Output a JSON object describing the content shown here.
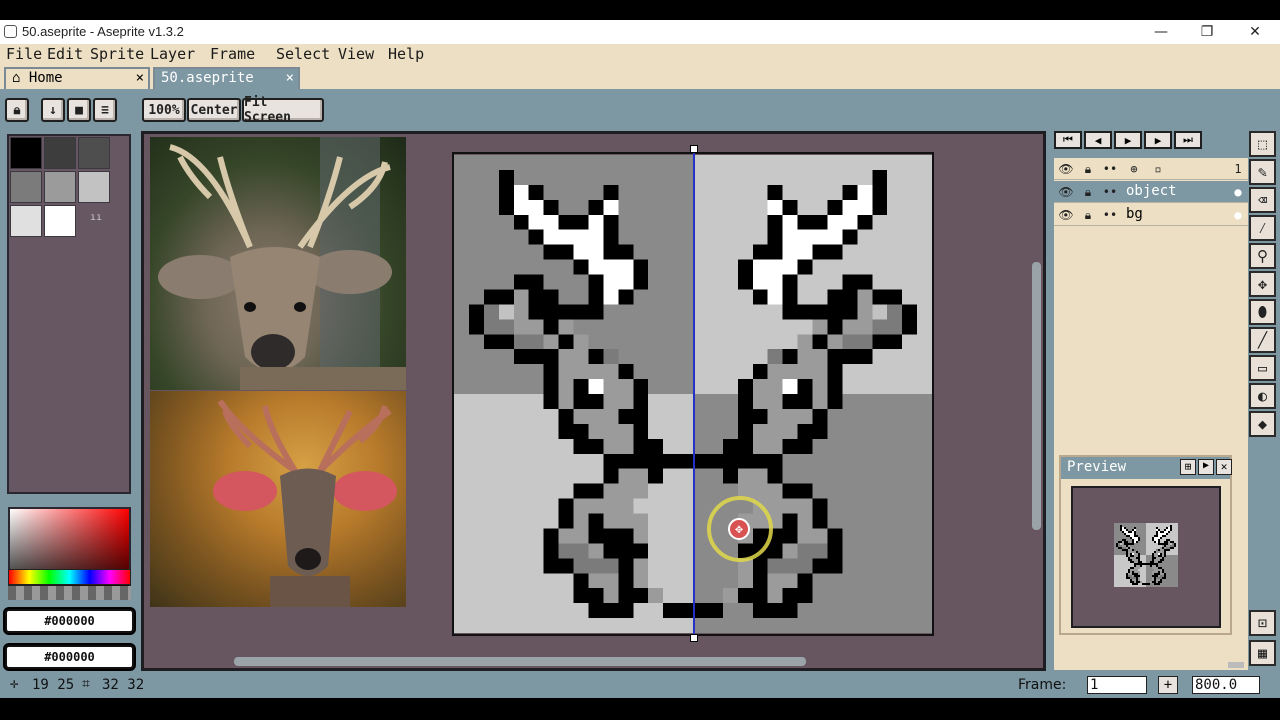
{
  "window": {
    "title": "50.aseprite - Aseprite v1.3.2",
    "minimize": "—",
    "maximize": "❐",
    "close": "✕"
  },
  "menu": [
    "File",
    "Edit",
    "Sprite",
    "Layer",
    "Frame",
    "Select",
    "View",
    "Help"
  ],
  "tabs": [
    {
      "label": "Home",
      "close": "×"
    },
    {
      "label": "50.aseprite",
      "close": "×"
    }
  ],
  "toolbar": {
    "zoom_100": "100%",
    "center": "Center",
    "fit_screen": "Fit Screen"
  },
  "palette": {
    "colors": [
      "#000000",
      "#2a2a2a",
      "#3d3d3d",
      "#4e4e4e",
      "#7b7b7b",
      "#9b9b9b",
      "#c2c2c2",
      "#e0e0e0",
      "#ffffff"
    ],
    "foreground": "#000000",
    "background": "#000000"
  },
  "timeline": {
    "frame_number": "1",
    "layers": [
      {
        "name": "object"
      },
      {
        "name": "bg"
      }
    ]
  },
  "preview": {
    "title": "Preview"
  },
  "status": {
    "cursor": "19 25",
    "size": "32 32",
    "frame_label": "Frame:",
    "frame_value": "1",
    "zoom_value": "800.0"
  },
  "colors": {
    "workspace": "#7d97a3",
    "panel": "#ecdfc4",
    "editor_bg": "#67565f",
    "accent_blue": "#2530c8"
  }
}
